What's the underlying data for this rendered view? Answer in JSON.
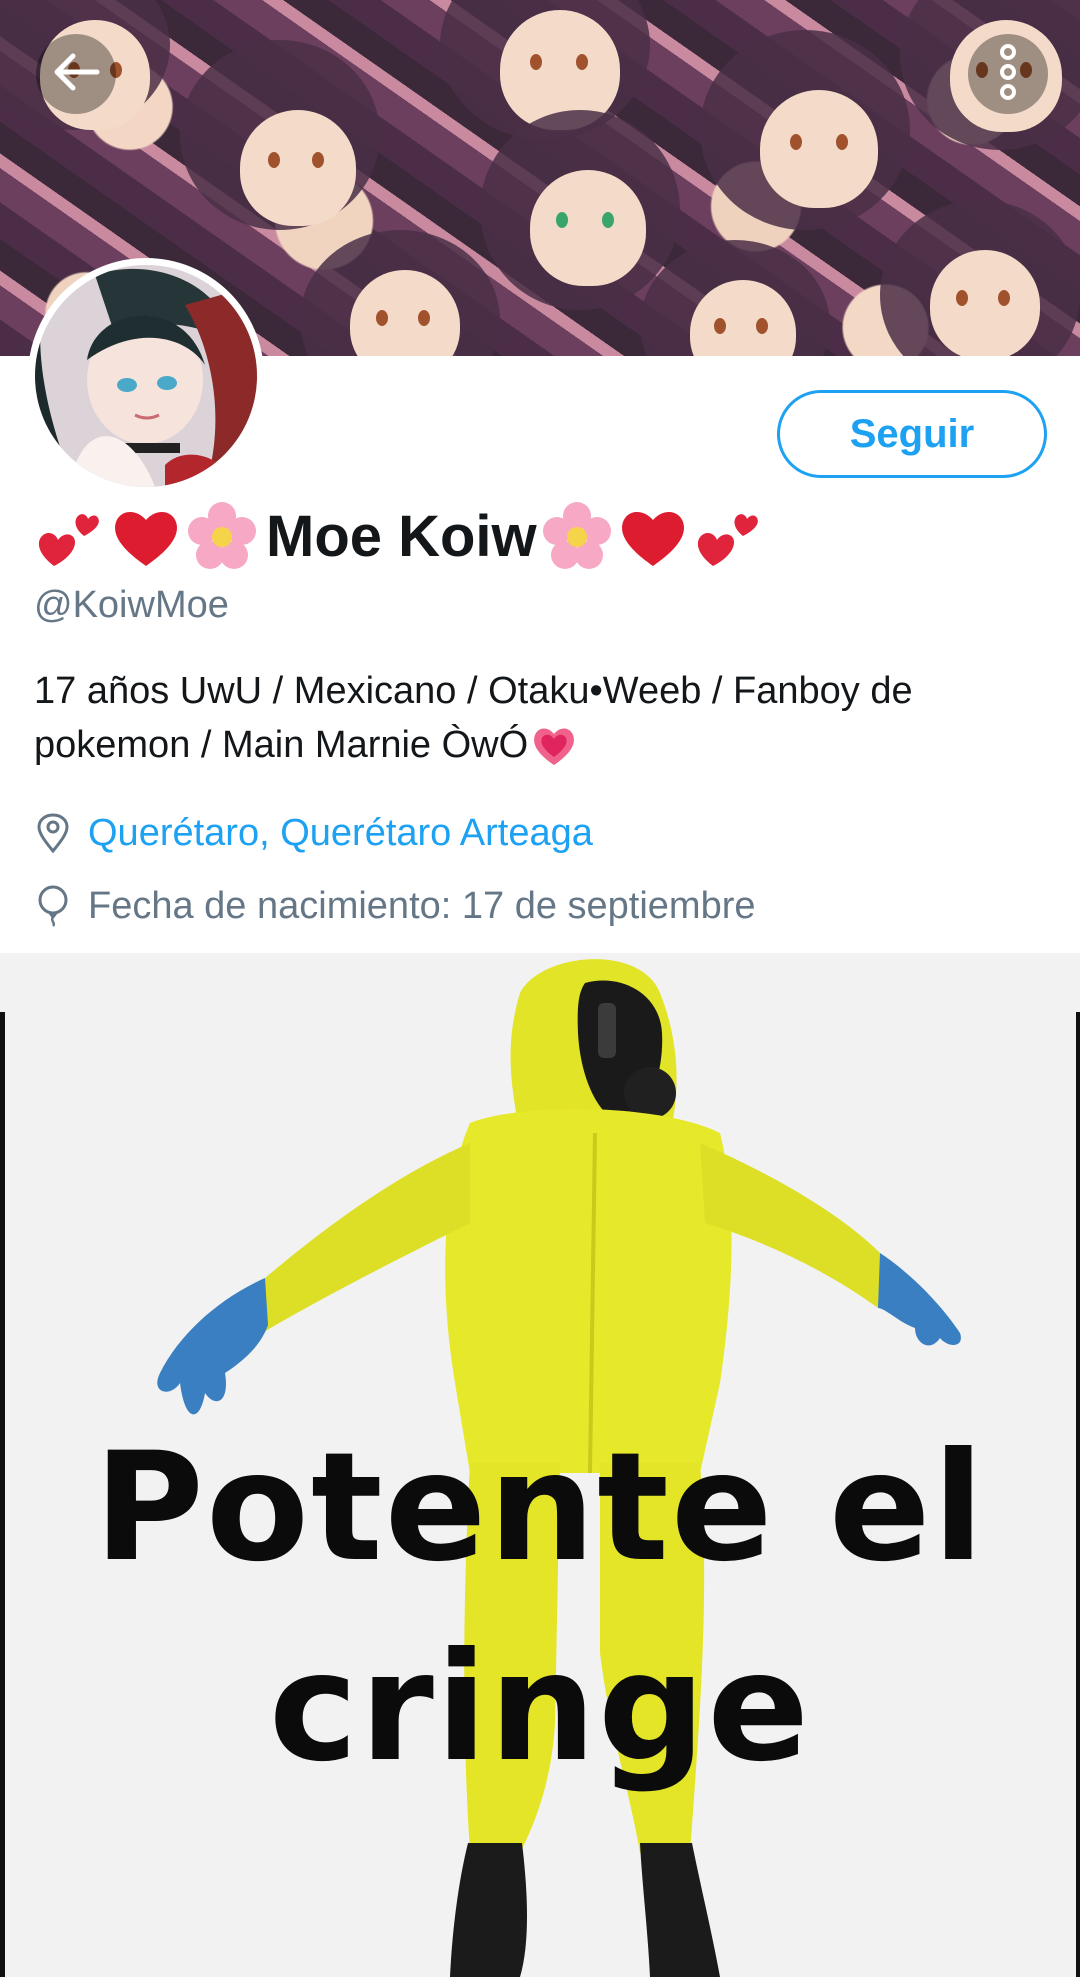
{
  "header": {
    "back_icon": "arrow-left-icon",
    "more_icon": "more-vertical-icon"
  },
  "profile": {
    "display_name": "Moe Koiw",
    "name_emoji_left": [
      "two-hearts",
      "red-heart",
      "cherry-blossom"
    ],
    "name_emoji_right": [
      "cherry-blossom",
      "red-heart",
      "two-hearts"
    ],
    "handle": "@KoiwMoe",
    "bio_line1": "17 años UwU / Mexicano / Otaku•Weeb / Fanboy de",
    "bio_line2": "pokemon / Main Marnie ÒwÓ",
    "bio_trailing_emoji": "sparkling-heart",
    "location": "Querétaro, Querétaro Arteaga",
    "birthday": "Fecha de nacimiento: 17 de septiembre"
  },
  "actions": {
    "follow_label": "Seguir"
  },
  "meme": {
    "caption_line1": "Potente el",
    "caption_line2": "cringe"
  },
  "colors": {
    "accent": "#1da1f2",
    "text_primary": "#14171a",
    "text_secondary": "#657786",
    "hazmat_yellow": "#e6e82a",
    "glove_blue": "#3a7fc1"
  }
}
